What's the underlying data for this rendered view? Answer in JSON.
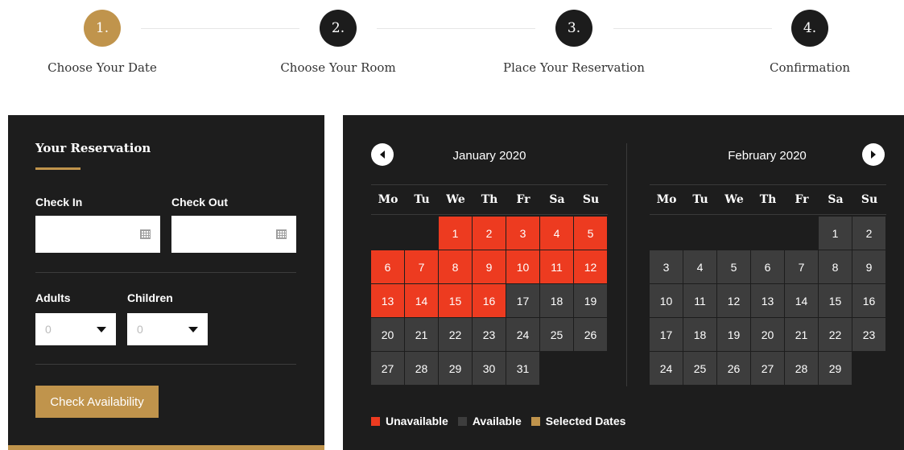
{
  "steps": [
    {
      "number": "1.",
      "label": "Choose Your Date",
      "active": true
    },
    {
      "number": "2.",
      "label": "Choose Your Room",
      "active": false
    },
    {
      "number": "3.",
      "label": "Place Your Reservation",
      "active": false
    },
    {
      "number": "4.",
      "label": "Confirmation",
      "active": false
    }
  ],
  "reservation": {
    "title": "Your Reservation",
    "check_in_label": "Check In",
    "check_out_label": "Check Out",
    "check_in_value": "",
    "check_out_value": "",
    "adults_label": "Adults",
    "children_label": "Children",
    "adults_value": "0",
    "children_value": "0",
    "button_label": "Check Availability"
  },
  "calendar": {
    "months": [
      {
        "title": "January 2020",
        "first_weekday_index": 2,
        "days_in_month": 31,
        "unavailable": [
          1,
          2,
          3,
          4,
          5,
          6,
          7,
          8,
          9,
          10,
          11,
          12,
          13,
          14,
          15,
          16
        ]
      },
      {
        "title": "February 2020",
        "first_weekday_index": 5,
        "days_in_month": 29,
        "unavailable": []
      }
    ],
    "weekdays": [
      "Mo",
      "Tu",
      "We",
      "Th",
      "Fr",
      "Sa",
      "Su"
    ],
    "legend": [
      {
        "label": "Unavailable",
        "color": "#ed3b20"
      },
      {
        "label": "Available",
        "color": "#3d3d3d"
      },
      {
        "label": "Selected Dates",
        "color": "#c0944c"
      }
    ]
  },
  "colors": {
    "accent": "#c0944c",
    "panel": "#1d1d1d",
    "unavailable": "#ed3b20",
    "available": "#3d3d3d"
  }
}
